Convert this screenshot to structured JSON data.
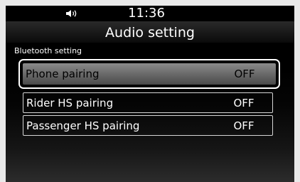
{
  "status_bar": {
    "volume_icon": "speaker-volume-icon",
    "time": "11:36"
  },
  "header": {
    "title": "Audio setting"
  },
  "section": {
    "label": "Bluetooth setting"
  },
  "rows": [
    {
      "label": "Phone pairing",
      "value": "OFF",
      "selected": true
    },
    {
      "label": "Rider HS pairing",
      "value": "OFF",
      "selected": false
    },
    {
      "label": "Passenger HS pairing",
      "value": "OFF",
      "selected": false
    }
  ],
  "colors": {
    "background": "#000000",
    "text": "#ffffff",
    "selected_fill": "#6a6a6a"
  }
}
